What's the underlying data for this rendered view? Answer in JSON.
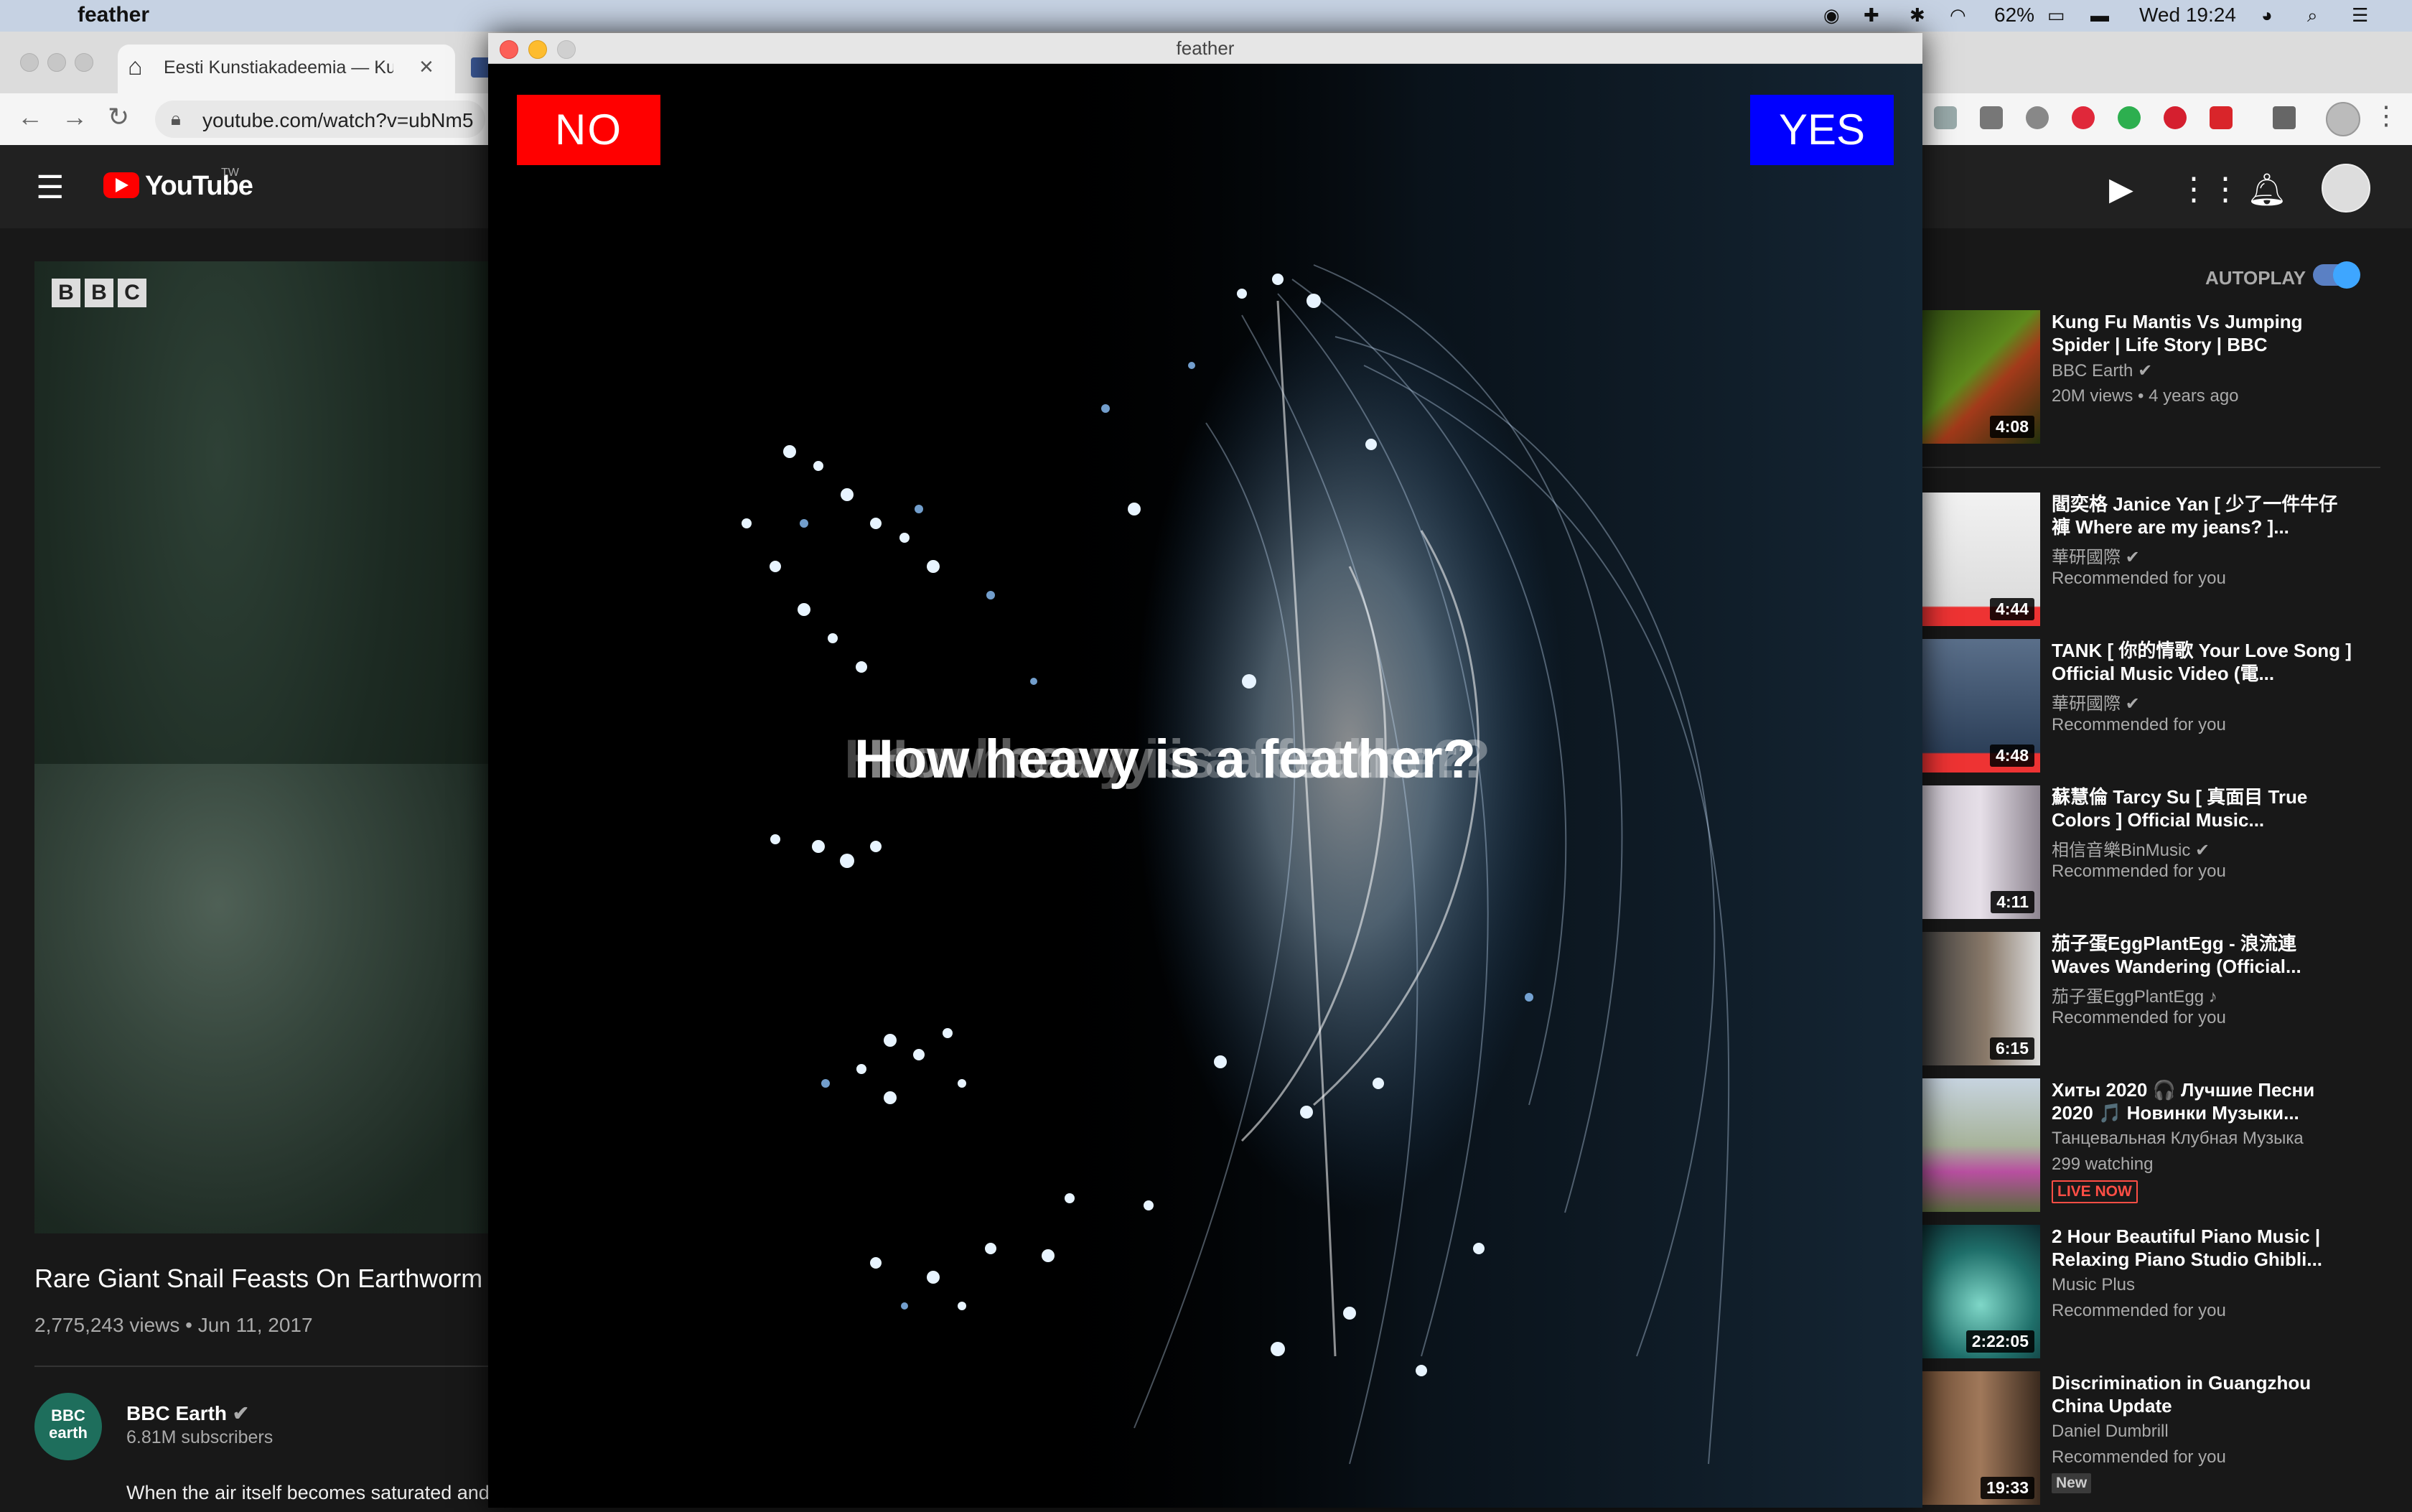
{
  "menubar": {
    "app_name": "feather",
    "battery": "62%",
    "clock": "Wed 19:24"
  },
  "browser": {
    "tab_title": "Eesti Kunstiakadeemia — Kunstiakadeemia",
    "url": "youtube.com/watch?v=ubNm5"
  },
  "youtube": {
    "brand": "YouTube",
    "brand_mark": "TW",
    "video": {
      "title": "Rare Giant Snail Feasts On Earthworm |",
      "views": "2,775,243 views",
      "date": "Jun 11, 2017",
      "channel": "BBC Earth",
      "channel_avatar": "BBC earth",
      "subscribers": "6.81M subscribers",
      "description": "When the air itself becomes saturated and the temperature is just right, rare giants start to emerge.",
      "watermark": [
        "B",
        "B",
        "C"
      ]
    },
    "autoplay_label": "AUTOPLAY",
    "recommendations": [
      {
        "title": "Kung Fu Mantis Vs Jumping Spider | Life Story | BBC",
        "channel": "BBC Earth",
        "meta": "20M views • 4 years ago",
        "duration": "4:08",
        "badge": ""
      },
      {
        "title": "閻奕格 Janice Yan [ 少了一件牛仔褲 Where are my jeans? ]...",
        "channel": "華研國際",
        "meta": "Recommended for you",
        "duration": "4:44",
        "badge": ""
      },
      {
        "title": "TANK [ 你的情歌 Your Love Song ] Official Music Video (電...",
        "channel": "華研國際",
        "meta": "Recommended for you",
        "duration": "4:48",
        "badge": ""
      },
      {
        "title": "蘇慧倫 Tarcy Su [ 真面目 True Colors ] Official Music...",
        "channel": "相信音樂BinMusic",
        "meta": "Recommended for you",
        "duration": "4:11",
        "badge": ""
      },
      {
        "title": "茄子蛋EggPlantEgg - 浪流連 Waves Wandering (Official...",
        "channel": "茄子蛋EggPlantEgg ♪",
        "meta": "Recommended for you",
        "duration": "6:15",
        "badge": ""
      },
      {
        "title": "Хиты 2020 🎧 Лучшие Песни 2020 🎵 Новинки Музыки...",
        "channel": "Танцевальная Клубная Музыка",
        "meta": "299 watching",
        "duration": "",
        "badge": "LIVE NOW"
      },
      {
        "title": "2 Hour Beautiful Piano Music | Relaxing Piano Studio Ghibli...",
        "channel": "Music Plus",
        "meta": "Recommended for you",
        "duration": "2:22:05",
        "badge": ""
      },
      {
        "title": "Discrimination in Guangzhou China Update",
        "channel": "Daniel Dumbrill",
        "meta": "Recommended for you",
        "duration": "19:33",
        "badge": "New"
      }
    ]
  },
  "feather": {
    "window_title": "feather",
    "no_label": "NO",
    "yes_label": "YES",
    "question": "How heavy is a feather?"
  },
  "colors": {
    "no_button": "#ff0000",
    "yes_button": "#0000ff",
    "yt_red": "#ff0000",
    "autoplay_blue": "#3ea6ff"
  }
}
